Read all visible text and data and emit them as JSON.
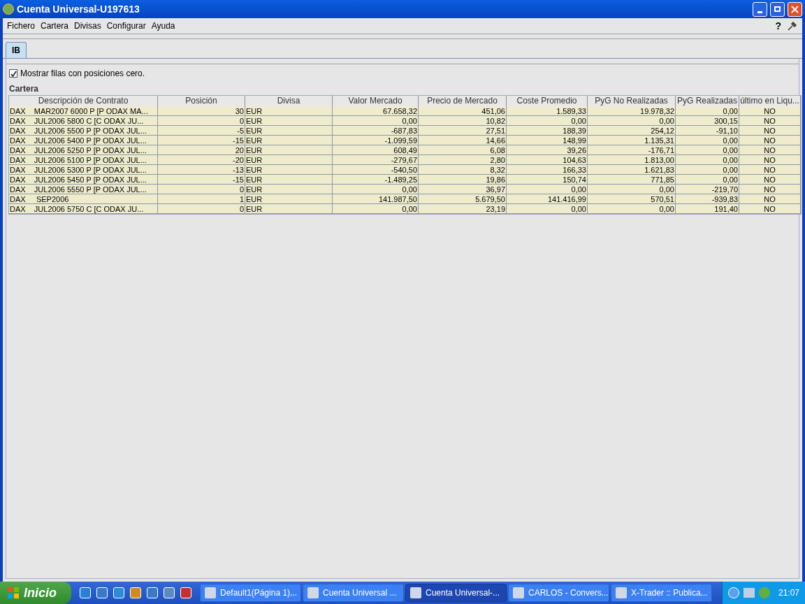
{
  "window": {
    "title": "Cuenta Universal-U197613"
  },
  "menu": [
    {
      "label": "Fichero"
    },
    {
      "label": "Cartera"
    },
    {
      "label": "Divisas"
    },
    {
      "label": "Configurar"
    },
    {
      "label": "Ayuda"
    }
  ],
  "help_button": "?",
  "tabs": [
    {
      "label": "IB",
      "selected": true
    }
  ],
  "zero_rows_checkbox": {
    "label": "Mostrar filas con posiciones cero.",
    "checked": true
  },
  "section_title": "Cartera",
  "table": {
    "columns": [
      {
        "label": "Descripción de Contrato",
        "kind": "text"
      },
      {
        "label": "Posición",
        "kind": "number"
      },
      {
        "label": "Divisa",
        "kind": "text"
      },
      {
        "label": "Valor Mercado",
        "kind": "number"
      },
      {
        "label": "Precio de Mercado",
        "kind": "number"
      },
      {
        "label": "Coste Promedio",
        "kind": "number"
      },
      {
        "label": "PyG No Realizadas",
        "kind": "number"
      },
      {
        "label": "PyG Realizadas",
        "kind": "number"
      },
      {
        "label": "último en Liqu...",
        "kind": "flag"
      }
    ],
    "rows": [
      [
        "DAX    MAR2007 6000 P [P ODAX MA...",
        "30",
        "EUR",
        "67.658,32",
        "451,06",
        "1.589,33",
        "19.978,32",
        "0,00",
        "NO"
      ],
      [
        "DAX    JUL2006 5800 C [C ODAX JU...",
        "0",
        "EUR",
        "0,00",
        "10,82",
        "0,00",
        "0,00",
        "300,15",
        "NO"
      ],
      [
        "DAX    JUL2006 5500 P [P ODAX JUL...",
        "-5",
        "EUR",
        "-687,83",
        "27,51",
        "188,39",
        "254,12",
        "-91,10",
        "NO"
      ],
      [
        "DAX    JUL2006 5400 P [P ODAX JUL...",
        "-15",
        "EUR",
        "-1.099,59",
        "14,66",
        "148,99",
        "1.135,31",
        "0,00",
        "NO"
      ],
      [
        "DAX    JUL2006 5250 P [P ODAX JUL...",
        "20",
        "EUR",
        "608,49",
        "6,08",
        "39,26",
        "-176,71",
        "0,00",
        "NO"
      ],
      [
        "DAX    JUL2006 5100 P [P ODAX JUL...",
        "-20",
        "EUR",
        "-279,67",
        "2,80",
        "104,63",
        "1.813,00",
        "0,00",
        "NO"
      ],
      [
        "DAX    JUL2006 5300 P [P ODAX JUL...",
        "-13",
        "EUR",
        "-540,50",
        "8,32",
        "166,33",
        "1.621,83",
        "0,00",
        "NO"
      ],
      [
        "DAX    JUL2006 5450 P [P ODAX JUL...",
        "-15",
        "EUR",
        "-1.489,25",
        "19,86",
        "150,74",
        "771,85",
        "0,00",
        "NO"
      ],
      [
        "DAX    JUL2006 5550 P [P ODAX JUL...",
        "0",
        "EUR",
        "0,00",
        "36,97",
        "0,00",
        "0,00",
        "-219,70",
        "NO"
      ],
      [
        "DAX     SEP2006",
        "1",
        "EUR",
        "141.987,50",
        "5.679,50",
        "141.416,99",
        "570,51",
        "-939,83",
        "NO"
      ],
      [
        "DAX    JUL2006 5750 C [C ODAX JU...",
        "0",
        "EUR",
        "0,00",
        "23,19",
        "0,00",
        "0,00",
        "191,40",
        "NO"
      ]
    ]
  },
  "taskbar": {
    "start": "Inicio",
    "tasks": [
      {
        "label": "Default1(Página 1)...",
        "selected": false
      },
      {
        "label": "Cuenta Universal ...",
        "selected": false
      },
      {
        "label": "Cuenta Universal-...",
        "selected": true
      },
      {
        "label": "CARLOS - Convers...",
        "selected": false
      },
      {
        "label": "X-Trader :: Publica...",
        "selected": false
      }
    ],
    "clock": "21:07"
  }
}
